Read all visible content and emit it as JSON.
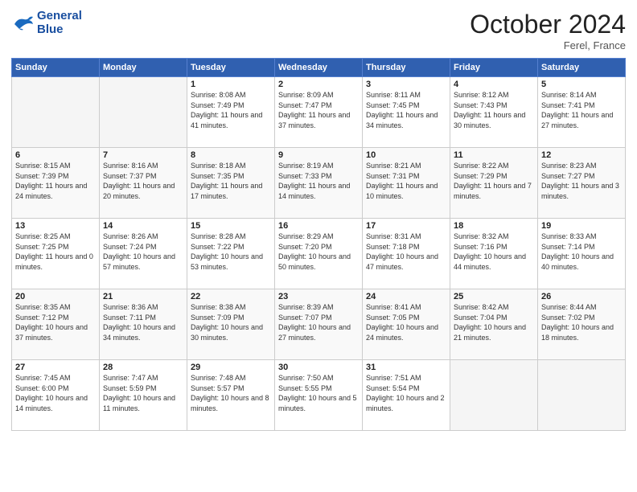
{
  "header": {
    "logo_line1": "General",
    "logo_line2": "Blue",
    "month": "October 2024",
    "location": "Ferel, France"
  },
  "days_of_week": [
    "Sunday",
    "Monday",
    "Tuesday",
    "Wednesday",
    "Thursday",
    "Friday",
    "Saturday"
  ],
  "weeks": [
    [
      {
        "day": "",
        "empty": true
      },
      {
        "day": "",
        "empty": true
      },
      {
        "day": "1",
        "sunrise": "Sunrise: 8:08 AM",
        "sunset": "Sunset: 7:49 PM",
        "daylight": "Daylight: 11 hours and 41 minutes."
      },
      {
        "day": "2",
        "sunrise": "Sunrise: 8:09 AM",
        "sunset": "Sunset: 7:47 PM",
        "daylight": "Daylight: 11 hours and 37 minutes."
      },
      {
        "day": "3",
        "sunrise": "Sunrise: 8:11 AM",
        "sunset": "Sunset: 7:45 PM",
        "daylight": "Daylight: 11 hours and 34 minutes."
      },
      {
        "day": "4",
        "sunrise": "Sunrise: 8:12 AM",
        "sunset": "Sunset: 7:43 PM",
        "daylight": "Daylight: 11 hours and 30 minutes."
      },
      {
        "day": "5",
        "sunrise": "Sunrise: 8:14 AM",
        "sunset": "Sunset: 7:41 PM",
        "daylight": "Daylight: 11 hours and 27 minutes."
      }
    ],
    [
      {
        "day": "6",
        "sunrise": "Sunrise: 8:15 AM",
        "sunset": "Sunset: 7:39 PM",
        "daylight": "Daylight: 11 hours and 24 minutes."
      },
      {
        "day": "7",
        "sunrise": "Sunrise: 8:16 AM",
        "sunset": "Sunset: 7:37 PM",
        "daylight": "Daylight: 11 hours and 20 minutes."
      },
      {
        "day": "8",
        "sunrise": "Sunrise: 8:18 AM",
        "sunset": "Sunset: 7:35 PM",
        "daylight": "Daylight: 11 hours and 17 minutes."
      },
      {
        "day": "9",
        "sunrise": "Sunrise: 8:19 AM",
        "sunset": "Sunset: 7:33 PM",
        "daylight": "Daylight: 11 hours and 14 minutes."
      },
      {
        "day": "10",
        "sunrise": "Sunrise: 8:21 AM",
        "sunset": "Sunset: 7:31 PM",
        "daylight": "Daylight: 11 hours and 10 minutes."
      },
      {
        "day": "11",
        "sunrise": "Sunrise: 8:22 AM",
        "sunset": "Sunset: 7:29 PM",
        "daylight": "Daylight: 11 hours and 7 minutes."
      },
      {
        "day": "12",
        "sunrise": "Sunrise: 8:23 AM",
        "sunset": "Sunset: 7:27 PM",
        "daylight": "Daylight: 11 hours and 3 minutes."
      }
    ],
    [
      {
        "day": "13",
        "sunrise": "Sunrise: 8:25 AM",
        "sunset": "Sunset: 7:25 PM",
        "daylight": "Daylight: 11 hours and 0 minutes."
      },
      {
        "day": "14",
        "sunrise": "Sunrise: 8:26 AM",
        "sunset": "Sunset: 7:24 PM",
        "daylight": "Daylight: 10 hours and 57 minutes."
      },
      {
        "day": "15",
        "sunrise": "Sunrise: 8:28 AM",
        "sunset": "Sunset: 7:22 PM",
        "daylight": "Daylight: 10 hours and 53 minutes."
      },
      {
        "day": "16",
        "sunrise": "Sunrise: 8:29 AM",
        "sunset": "Sunset: 7:20 PM",
        "daylight": "Daylight: 10 hours and 50 minutes."
      },
      {
        "day": "17",
        "sunrise": "Sunrise: 8:31 AM",
        "sunset": "Sunset: 7:18 PM",
        "daylight": "Daylight: 10 hours and 47 minutes."
      },
      {
        "day": "18",
        "sunrise": "Sunrise: 8:32 AM",
        "sunset": "Sunset: 7:16 PM",
        "daylight": "Daylight: 10 hours and 44 minutes."
      },
      {
        "day": "19",
        "sunrise": "Sunrise: 8:33 AM",
        "sunset": "Sunset: 7:14 PM",
        "daylight": "Daylight: 10 hours and 40 minutes."
      }
    ],
    [
      {
        "day": "20",
        "sunrise": "Sunrise: 8:35 AM",
        "sunset": "Sunset: 7:12 PM",
        "daylight": "Daylight: 10 hours and 37 minutes."
      },
      {
        "day": "21",
        "sunrise": "Sunrise: 8:36 AM",
        "sunset": "Sunset: 7:11 PM",
        "daylight": "Daylight: 10 hours and 34 minutes."
      },
      {
        "day": "22",
        "sunrise": "Sunrise: 8:38 AM",
        "sunset": "Sunset: 7:09 PM",
        "daylight": "Daylight: 10 hours and 30 minutes."
      },
      {
        "day": "23",
        "sunrise": "Sunrise: 8:39 AM",
        "sunset": "Sunset: 7:07 PM",
        "daylight": "Daylight: 10 hours and 27 minutes."
      },
      {
        "day": "24",
        "sunrise": "Sunrise: 8:41 AM",
        "sunset": "Sunset: 7:05 PM",
        "daylight": "Daylight: 10 hours and 24 minutes."
      },
      {
        "day": "25",
        "sunrise": "Sunrise: 8:42 AM",
        "sunset": "Sunset: 7:04 PM",
        "daylight": "Daylight: 10 hours and 21 minutes."
      },
      {
        "day": "26",
        "sunrise": "Sunrise: 8:44 AM",
        "sunset": "Sunset: 7:02 PM",
        "daylight": "Daylight: 10 hours and 18 minutes."
      }
    ],
    [
      {
        "day": "27",
        "sunrise": "Sunrise: 7:45 AM",
        "sunset": "Sunset: 6:00 PM",
        "daylight": "Daylight: 10 hours and 14 minutes."
      },
      {
        "day": "28",
        "sunrise": "Sunrise: 7:47 AM",
        "sunset": "Sunset: 5:59 PM",
        "daylight": "Daylight: 10 hours and 11 minutes."
      },
      {
        "day": "29",
        "sunrise": "Sunrise: 7:48 AM",
        "sunset": "Sunset: 5:57 PM",
        "daylight": "Daylight: 10 hours and 8 minutes."
      },
      {
        "day": "30",
        "sunrise": "Sunrise: 7:50 AM",
        "sunset": "Sunset: 5:55 PM",
        "daylight": "Daylight: 10 hours and 5 minutes."
      },
      {
        "day": "31",
        "sunrise": "Sunrise: 7:51 AM",
        "sunset": "Sunset: 5:54 PM",
        "daylight": "Daylight: 10 hours and 2 minutes."
      },
      {
        "day": "",
        "empty": true
      },
      {
        "day": "",
        "empty": true
      }
    ]
  ]
}
